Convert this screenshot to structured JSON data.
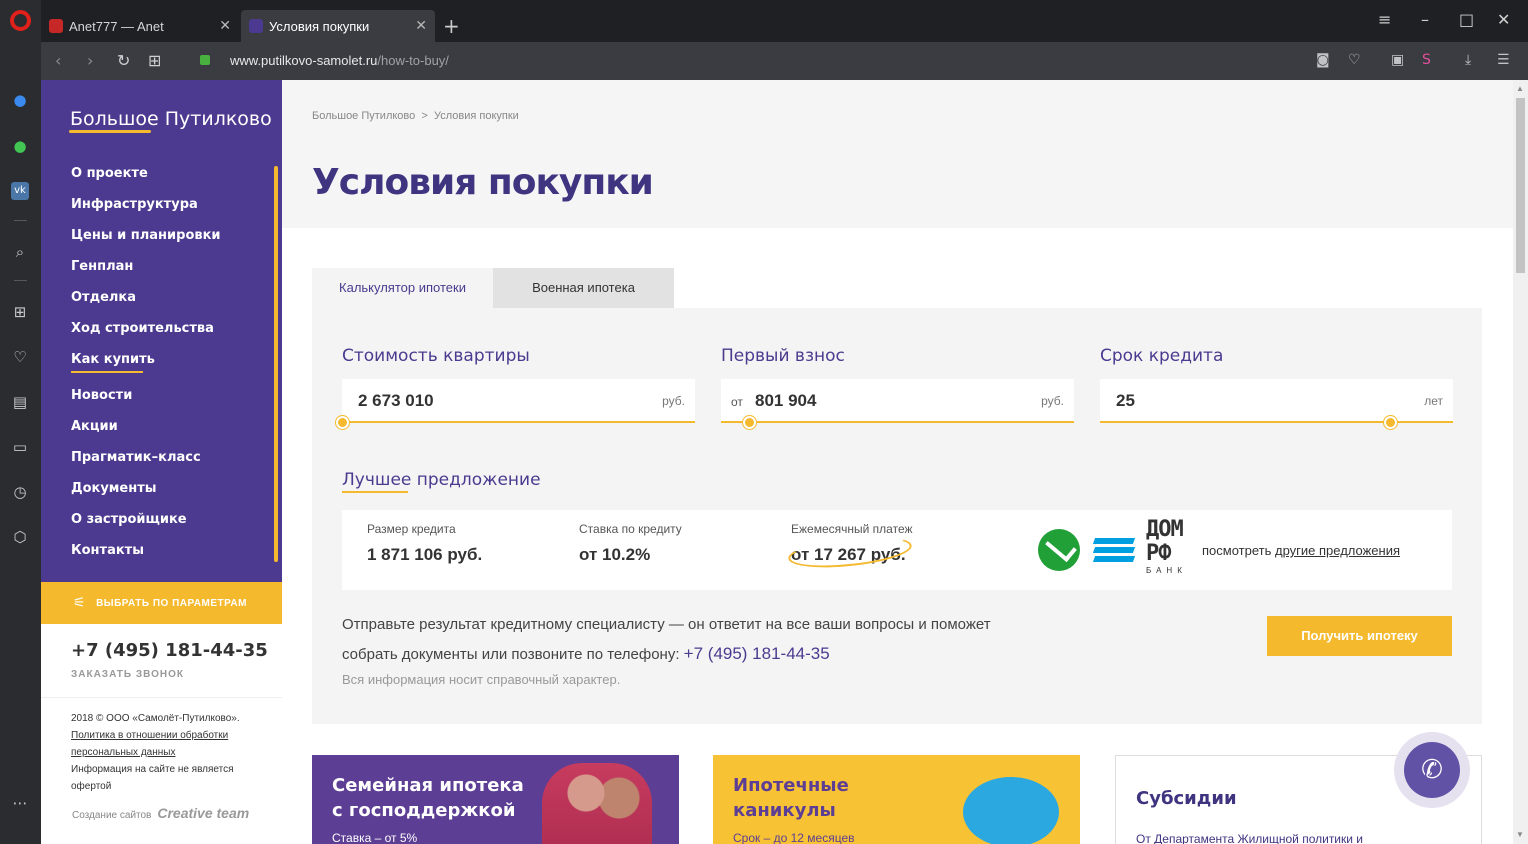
{
  "browser": {
    "tabs": [
      {
        "title": "Anet777 — Anet",
        "active": false
      },
      {
        "title": "Условия покупки",
        "active": true
      }
    ],
    "url_domain": "www.putilkovo-samolet.ru",
    "url_path": "/how-to-buy/",
    "new_tab": "+",
    "rail_icons": [
      "messenger-icon",
      "whatsapp-icon",
      "vk-icon",
      "search-icon",
      "speed-dial-icon",
      "heart-icon",
      "news-icon",
      "player-icon",
      "history-icon",
      "cube-icon",
      "more-icon"
    ]
  },
  "sidebar": {
    "logo": "Большое Путилково",
    "menu": [
      "О проекте",
      "Инфраструктура",
      "Цены и планировки",
      "Генплан",
      "Отделка",
      "Ход строительства",
      "Как купить",
      "Новости",
      "Акции",
      "Прагматик–класс",
      "Документы",
      "О застройщике",
      "Контакты"
    ],
    "filter_button": "ВЫБРАТЬ ПО ПАРАМЕТРАМ",
    "phone": "+7 (495) 181-44-35",
    "call_request": "ЗАКАЗАТЬ ЗВОНОК",
    "copyright": "2018 © ООО «Самолёт-Путилково».",
    "privacy": "Политика в отношении обработки персональных данных",
    "disclaimer": "Информация на сайте не является офертой",
    "credit_label": "Создание сайтов",
    "credit_brand": "Creative team"
  },
  "main": {
    "breadcrumb_home": "Большое Путилково",
    "breadcrumb_sep": ">",
    "breadcrumb_current": "Условия покупки",
    "title": "Условия покупки",
    "tabs": [
      "Калькулятор ипотеки",
      "Военная ипотека"
    ],
    "fields": {
      "price": {
        "label": "Стоимость квартиры",
        "value": "2 673 010",
        "unit": "руб."
      },
      "down": {
        "label": "Первый взнос",
        "prefix": "от",
        "value": "801 904",
        "unit": "руб."
      },
      "term": {
        "label": "Срок кредита",
        "value": "25",
        "unit": "лет"
      }
    },
    "best_offer": "Лучшее предложение",
    "offer": {
      "loan_label": "Размер кредита",
      "loan_value": "1 871 106 руб.",
      "rate_label": "Ставка по кредиту",
      "rate_value": "от 10.2%",
      "payment_label": "Ежемесячный платеж",
      "payment_value": "от 17 267 руб.",
      "more_prefix": "посмотреть ",
      "more_link": "другие предложения",
      "dom_logo_top": "ДОМ",
      "dom_logo_mid": "РФ",
      "dom_logo_bank": "БАНК"
    },
    "note_text": "Отправьте результат кредитному специалисту — он ответит на все ваши вопросы и поможет собрать документы или позвоните по телефону: ",
    "note_phone": "+7 (495) 181-44-35",
    "note_small": "Вся информация носит справочный характер.",
    "get_mortgage": "Получить ипотеку",
    "cards": [
      {
        "title": "Семейная ипотека с господдержкой",
        "sub": "Ставка – от 5%"
      },
      {
        "title": "Ипотечные каникулы",
        "sub": "Срок – до 12 месяцев"
      },
      {
        "title": "Субсидии",
        "sub": "От Департамента Жилищной политики и"
      }
    ]
  },
  "colors": {
    "purple": "#4b3a8f",
    "yellow": "#f5b92e"
  }
}
